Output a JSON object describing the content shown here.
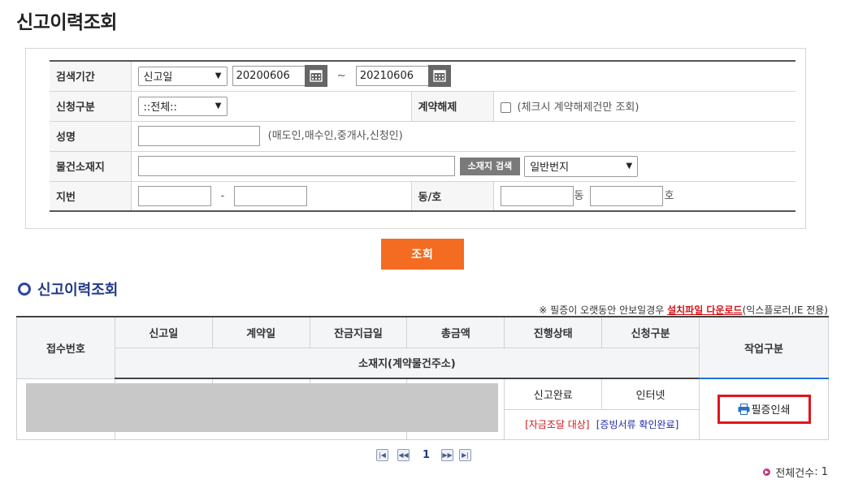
{
  "page": {
    "title": "신고이력조회"
  },
  "search": {
    "period_label": "검색기간",
    "period_type": "신고일",
    "date_from": "20200606",
    "date_sep": "~",
    "date_to": "20210606",
    "apply_type_label": "신청구분",
    "apply_type_value": "::전체::",
    "cancel_label": "계약해제",
    "cancel_hint": "(체크시 계약해제건만 조회)",
    "name_label": "성명",
    "name_hint": "(매도인,매수인,중개사,신청인)",
    "address_label": "물건소재지",
    "address_search_button": "소재지 검색",
    "address_type": "일반번지",
    "lot_label": "지번",
    "lot_sep": "-",
    "dongho_label": "동/호",
    "dong_suffix": "동",
    "ho_suffix": "호"
  },
  "query_button": "조회",
  "results": {
    "section_title": "신고이력조회",
    "note_prefix": "※ 필증이 오랫동안 안보일경우 ",
    "note_link": "설치파일 다운로드",
    "note_suffix": "(익스플로러,IE 전용)",
    "headers": {
      "receipt_no": "접수번호",
      "report_date": "신고일",
      "contract_date": "계약일",
      "balance_date": "잔금지급일",
      "total_amount": "총금액",
      "status": "진행상태",
      "apply_type": "신청구분",
      "address": "소재지(계약물건주소)",
      "work": "작업구분"
    },
    "rows": [
      {
        "status": "신고완료",
        "apply_type": "인터넷",
        "fund_tag": "[자금조달 대상]",
        "proof_tag": "[증빙서류 확인완료]",
        "print_button": "필증인쇄"
      }
    ]
  },
  "pagination": {
    "current": "1"
  },
  "total": {
    "label": "전체건수",
    "sep": ":",
    "count": "1"
  },
  "colors": {
    "accent_orange": "#f36c21",
    "work_header_blue": "#1a73e8",
    "highlight_red": "#e1141c",
    "section_navy": "#223a8a"
  }
}
